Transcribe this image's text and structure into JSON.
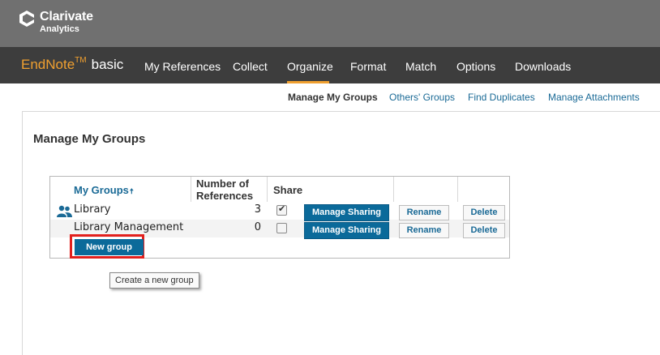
{
  "company": {
    "name": "Clarivate",
    "sub": "Analytics"
  },
  "brand": {
    "en": "EndNote",
    "tm": "TM",
    "basic": "basic"
  },
  "nav": {
    "my_references": "My References",
    "collect": "Collect",
    "organize": "Organize",
    "format": "Format",
    "match": "Match",
    "options": "Options",
    "downloads": "Downloads",
    "active": "Organize"
  },
  "subnav": {
    "manage_my_groups": "Manage My Groups",
    "others_groups": "Others' Groups",
    "find_duplicates": "Find Duplicates",
    "manage_attachments": "Manage Attachments"
  },
  "page_title": "Manage My Groups",
  "table": {
    "col_mygroups": "My Groups",
    "sort_arrow": "🠅",
    "col_num_line1": "Number of",
    "col_num_line2": "References",
    "col_share": "Share",
    "rows": [
      {
        "name": "Library",
        "count": "3",
        "shared": true,
        "manage_sharing": "Manage Sharing",
        "rename": "Rename",
        "delete": "Delete",
        "icon": "shared-users-icon"
      },
      {
        "name": "Library Management",
        "count": "0",
        "shared": false,
        "manage_sharing": "Manage Sharing",
        "rename": "Rename",
        "delete": "Delete"
      }
    ]
  },
  "new_group_button": "New group",
  "tooltip": "Create a new group",
  "colors": {
    "accent": "#f0a030",
    "button_blue": "#0b6a9a",
    "link": "#1a6a96",
    "highlight_red": "#e2201d"
  }
}
